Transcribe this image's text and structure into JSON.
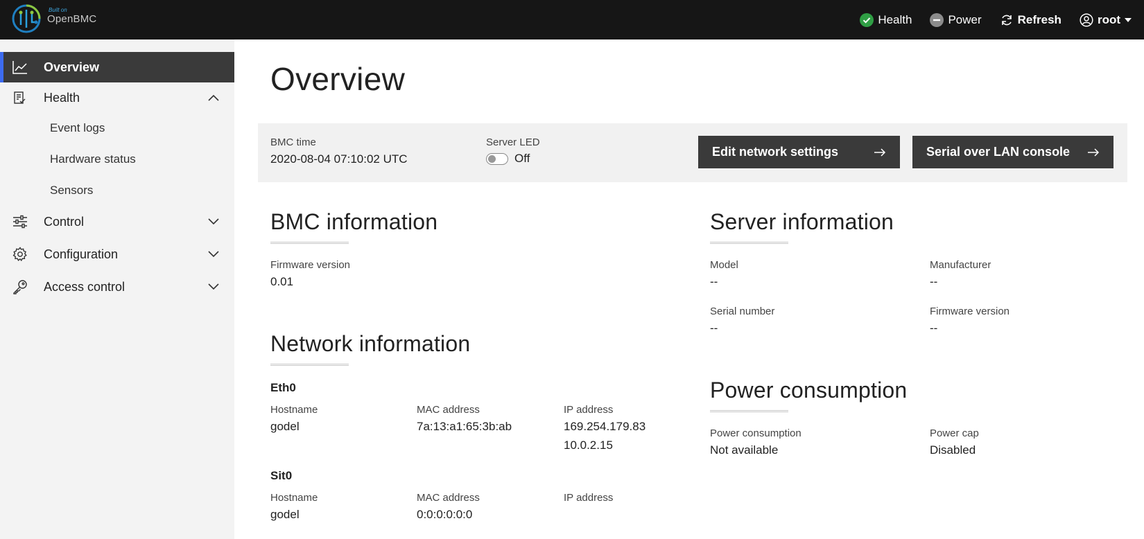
{
  "header": {
    "logo_small": "Built on",
    "logo_name": "OpenBMC",
    "health_label": "Health",
    "power_label": "Power",
    "refresh_label": "Refresh",
    "user_label": "root",
    "icons": [
      "check-circle-icon",
      "minus-circle-icon",
      "refresh-icon",
      "user-circle-icon",
      "caret-down-icon"
    ],
    "colors": {
      "health_ok": "#2f9e44",
      "power_off": "#8c8c8c",
      "bar": "#161616"
    }
  },
  "sidebar": {
    "overview": "Overview",
    "health": "Health",
    "health_children": [
      "Event logs",
      "Hardware status",
      "Sensors"
    ],
    "control": "Control",
    "configuration": "Configuration",
    "access_control": "Access control",
    "active_color": "#3d6bf0"
  },
  "page": {
    "title": "Overview"
  },
  "quick": {
    "bmc_time_label": "BMC time",
    "bmc_time_value": "2020-08-04 07:10:02 UTC",
    "server_led_label": "Server LED",
    "server_led_value": "Off",
    "edit_network_button": "Edit network settings",
    "sol_console_button": "Serial over LAN console"
  },
  "bmc_info": {
    "title": "BMC information",
    "firmware_label": "Firmware version",
    "firmware_value": "0.01"
  },
  "network_info": {
    "title": "Network information",
    "interfaces": [
      {
        "name": "Eth0",
        "hostname_label": "Hostname",
        "hostname": "godel",
        "mac_label": "MAC address",
        "mac": "7a:13:a1:65:3b:ab",
        "ip_label": "IP address",
        "ips": [
          "169.254.179.83",
          "10.0.2.15"
        ]
      },
      {
        "name": "Sit0",
        "hostname_label": "Hostname",
        "hostname": "godel",
        "mac_label": "MAC address",
        "mac": "0:0:0:0:0:0",
        "ip_label": "IP address",
        "ips": []
      }
    ]
  },
  "server_info": {
    "title": "Server information",
    "model_label": "Model",
    "model": "--",
    "manufacturer_label": "Manufacturer",
    "manufacturer": "--",
    "serial_label": "Serial number",
    "serial": "--",
    "firmware_label": "Firmware version",
    "firmware": "--"
  },
  "power": {
    "title": "Power consumption",
    "consumption_label": "Power consumption",
    "consumption_value": "Not available",
    "cap_label": "Power cap",
    "cap_value": "Disabled"
  }
}
